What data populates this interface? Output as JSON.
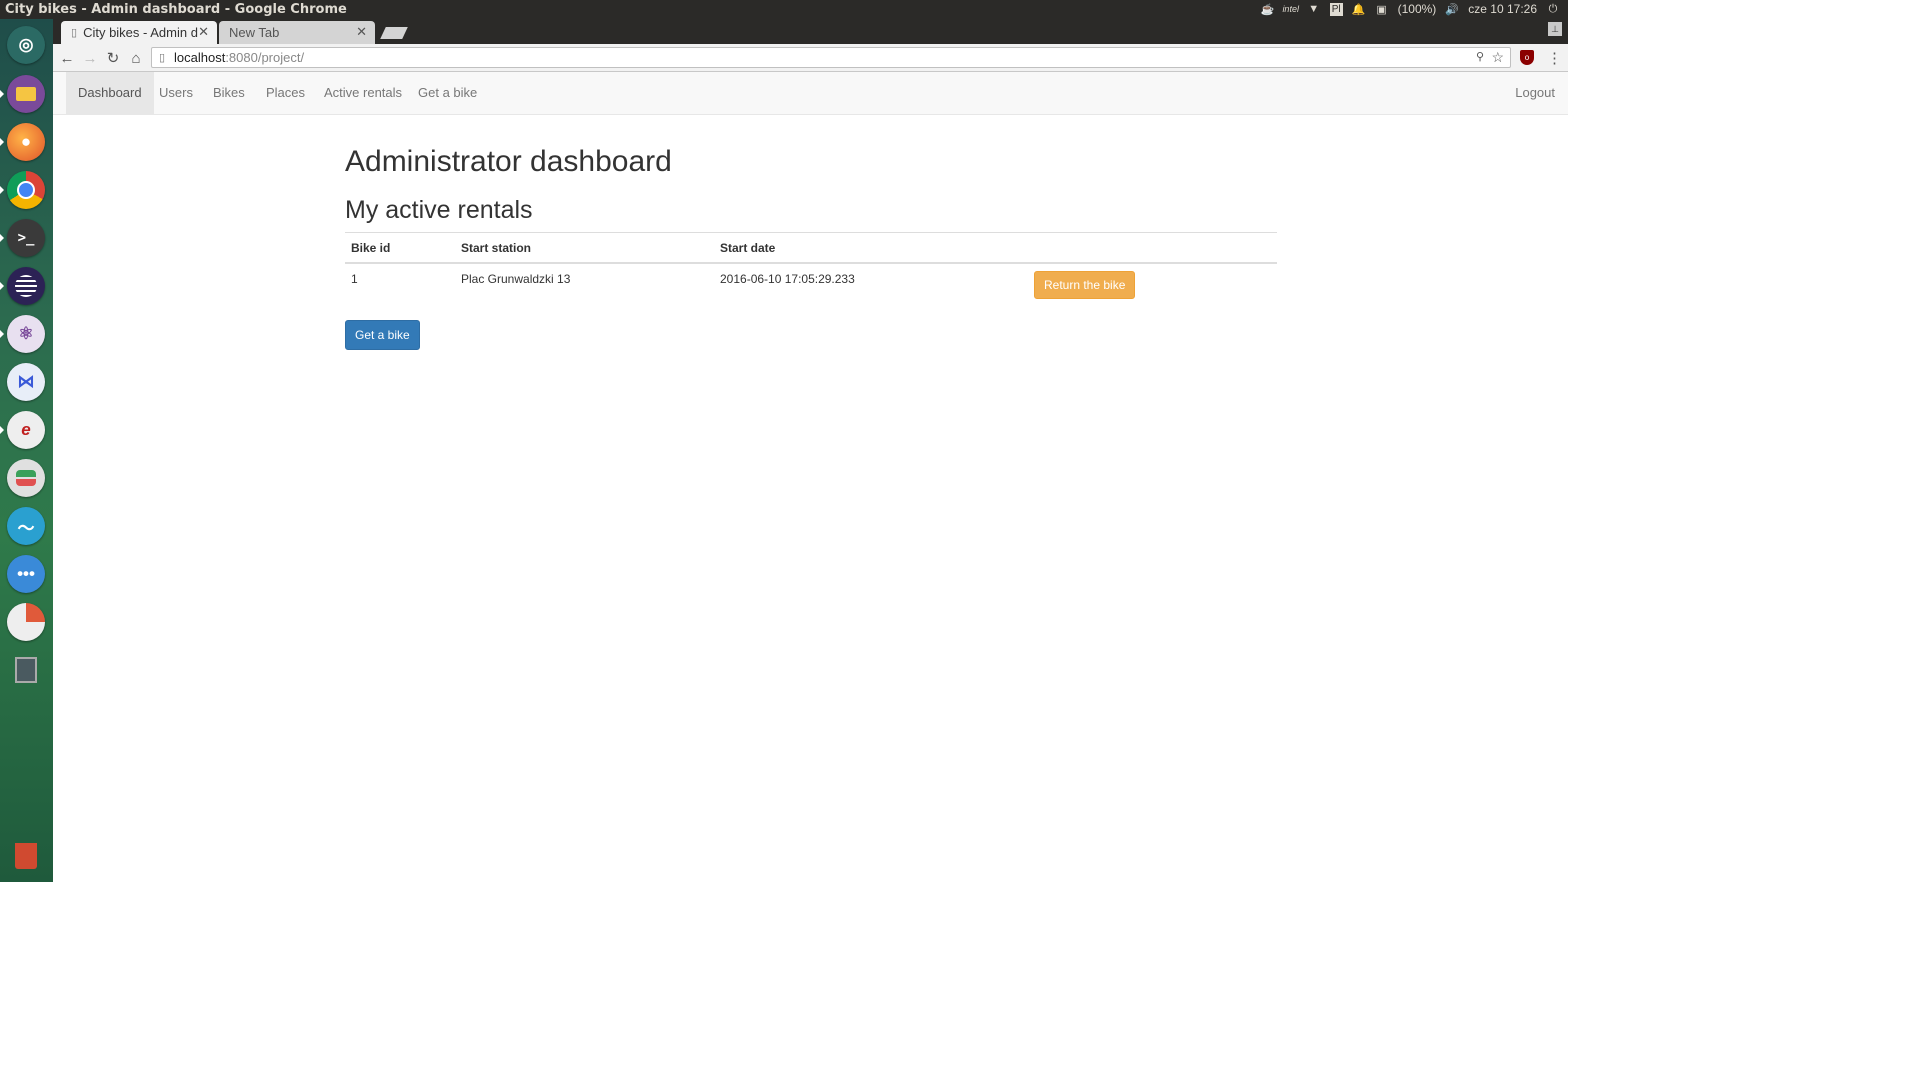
{
  "os": {
    "window_title": "City bikes - Admin dashboard - Google Chrome",
    "tray": {
      "keyboard": "Pl",
      "battery": "(100%)",
      "clock": "cze 10 17:26"
    }
  },
  "launcher": {
    "items": [
      {
        "name": "ubuntu-logo-icon",
        "color": "#2b6a64"
      },
      {
        "name": "files-icon",
        "color": "#7a4a9a"
      },
      {
        "name": "firefox-icon",
        "color": "#e06a2a"
      },
      {
        "name": "chrome-icon",
        "color": "#d94a3a"
      },
      {
        "name": "terminal-icon",
        "color": "#3a3a3a"
      },
      {
        "name": "eclipse-icon",
        "color": "#2c2255"
      },
      {
        "name": "atom-icon",
        "color": "#e8e0f0"
      },
      {
        "name": "vscode-icon",
        "color": "#e8eef8"
      },
      {
        "name": "pdf-editor-icon",
        "color": "#eeeeee"
      },
      {
        "name": "toggles-icon",
        "color": "#e0e0e0"
      },
      {
        "name": "messenger-icon",
        "color": "#2aa0d0"
      },
      {
        "name": "more-apps-icon",
        "color": "#3a8ad8"
      },
      {
        "name": "pie-app-icon",
        "color": "#eeeeee"
      },
      {
        "name": "search-app-icon",
        "color": "#4a5a60"
      },
      {
        "name": "trash-icon",
        "color": "#d04a30"
      }
    ]
  },
  "browser": {
    "tabs": [
      {
        "title": "City bikes - Admin d",
        "active": true
      },
      {
        "title": "New Tab",
        "active": false
      }
    ],
    "url_host": "localhost",
    "url_path": ":8080/project/"
  },
  "navbar": {
    "items": [
      "Dashboard",
      "Users",
      "Bikes",
      "Places",
      "Active rentals",
      "Get a bike"
    ],
    "active": "Dashboard",
    "logout": "Logout"
  },
  "main": {
    "title": "Administrator dashboard",
    "subtitle": "My active rentals",
    "table": {
      "headers": [
        "Bike id",
        "Start station",
        "Start date",
        ""
      ],
      "rows": [
        {
          "bike_id": "1",
          "start_station": "Plac Grunwaldzki 13",
          "start_date": "2016-06-10 17:05:29.233",
          "action": "Return the bike"
        }
      ]
    },
    "get_bike_button": "Get a bike"
  },
  "colors": {
    "primary": "#337ab7",
    "warning": "#f0ad4e",
    "navbar_bg": "#f8f8f8",
    "panel_bg": "#2b2a28"
  }
}
